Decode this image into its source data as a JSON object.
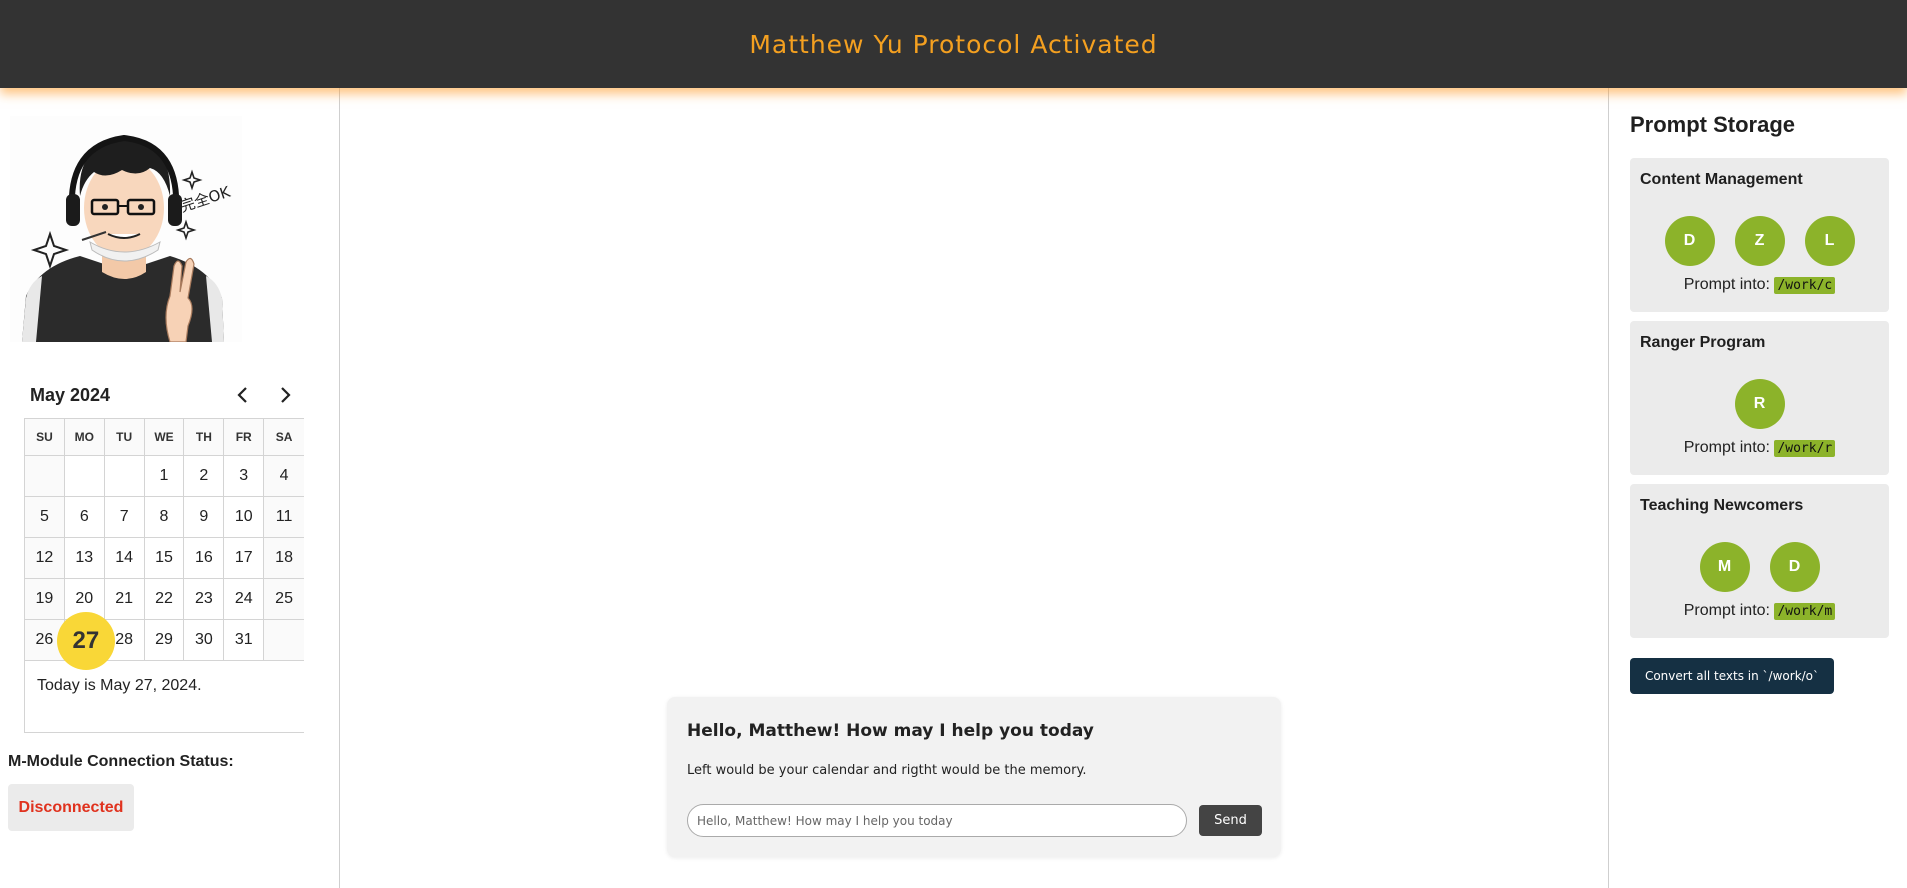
{
  "header": {
    "title": "Matthew Yu Protocol Activated"
  },
  "avatar": {
    "caption": "完全OK"
  },
  "calendar": {
    "month_label": "May 2024",
    "weekdays": [
      "SU",
      "MO",
      "TU",
      "WE",
      "TH",
      "FR",
      "SA"
    ],
    "weeks": [
      [
        "",
        "",
        "",
        "1",
        "2",
        "3",
        "4"
      ],
      [
        "5",
        "6",
        "7",
        "8",
        "9",
        "10",
        "11"
      ],
      [
        "12",
        "13",
        "14",
        "15",
        "16",
        "17",
        "18"
      ],
      [
        "19",
        "20",
        "21",
        "22",
        "23",
        "24",
        "25"
      ],
      [
        "26",
        "27",
        "28",
        "29",
        "30",
        "31",
        ""
      ]
    ],
    "today_day": "27",
    "today_text": "Today is May 27, 2024."
  },
  "connection": {
    "label": "M-Module Connection Status:",
    "status": "Disconnected",
    "status_color": "#e0321e"
  },
  "chat": {
    "greeting": "Hello, Matthew! How may I help you today",
    "description": "Left would be your calendar and rigtht would be the memory.",
    "placeholder": "Hello, Matthew! How may I help you today",
    "send_label": "Send"
  },
  "prompt_storage": {
    "title": "Prompt Storage",
    "groups": [
      {
        "title": "Content Management",
        "members": [
          "D",
          "Z",
          "L"
        ],
        "prompt_label": "Prompt into:",
        "path": "/work/c"
      },
      {
        "title": "Ranger Program",
        "members": [
          "R"
        ],
        "prompt_label": "Prompt into:",
        "path": "/work/r"
      },
      {
        "title": "Teaching Newcomers",
        "members": [
          "M",
          "D"
        ],
        "prompt_label": "Prompt into:",
        "path": "/work/m"
      }
    ],
    "convert_label": "Convert all texts in `/work/o`"
  },
  "colors": {
    "accent": "#f4a020",
    "topbar": "#333333",
    "member_green": "#8cb32a",
    "today_yellow": "#f9d737",
    "convert_button": "#153043"
  }
}
